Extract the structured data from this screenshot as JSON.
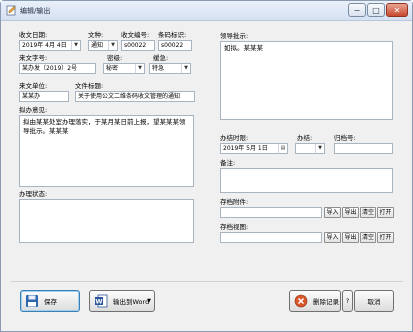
{
  "window": {
    "title": "编辑/输出",
    "minimize_glyph": "−",
    "maximize_glyph": "□",
    "close_glyph": "✕"
  },
  "form": {
    "receive_date_label": "收文日期:",
    "receive_date_value": "2019年 4月 4日",
    "doc_type_label": "文种:",
    "doc_type_value": "通知",
    "receive_no_label": "收文编号:",
    "receive_no_value": "s00022",
    "barcode_label": "条码标识:",
    "barcode_value": "s00022",
    "incoming_no_label": "来文字号:",
    "incoming_no_value": "某办发（2019）2号",
    "secret_label": "密级:",
    "secret_value": "秘密",
    "urgency_label": "缓急:",
    "urgency_value": "特急",
    "sender_label": "来文单位:",
    "sender_value": "某某办",
    "doc_title_label": "文件标题:",
    "doc_title_value": "关于使用公文二维条码收文管理的通知",
    "draft_opinion_label": "拟办意见:",
    "draft_opinion_value": "拟由某某处室办理落实，于某月某日前上报，望某某某领导批示。某某某",
    "status_label": "办理状态:",
    "status_value": "",
    "leader_label": "领导批示:",
    "leader_value": "如拟。某某某",
    "deadline_label": "办结时限:",
    "deadline_value": "2019年 5月 1日",
    "done_label": "办结:",
    "done_value": "",
    "archive_no_label": "归档号:",
    "archive_no_value": "",
    "remark_label": "备注:",
    "remark_value": "",
    "attachment_label": "存档附件:",
    "attachment_value": "",
    "view_label": "存档视图:",
    "view_value": ""
  },
  "file_buttons": {
    "import": "导入",
    "export": "导出",
    "clear": "清空",
    "open": "打开"
  },
  "footer": {
    "save": "保存",
    "export_word": "输出到Word",
    "delete_record": "删除记录",
    "help": "?",
    "cancel": "取消"
  },
  "colors": {
    "save_icon": "#2f67b1",
    "word_icon": "#2b579a",
    "delete_icon": "#d9562b"
  }
}
